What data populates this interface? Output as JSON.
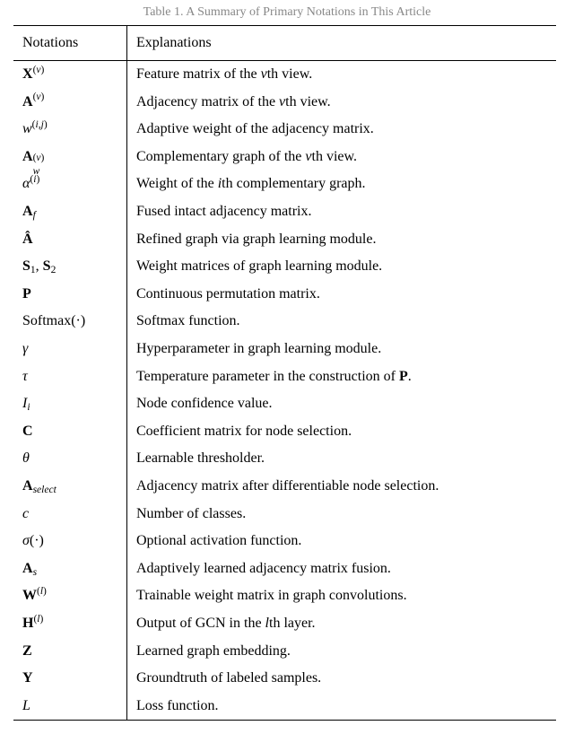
{
  "caption": "Table 1. A Summary of Primary Notations in This Article",
  "header": {
    "col1": "Notations",
    "col2": "Explanations"
  },
  "rows": [
    {
      "notation_html": "<span class='b'>X</span><span class='sup'>(<span class='i'>v</span>)</span>",
      "explanation_html": "Feature matrix of the <span class='i'>v</span>th view."
    },
    {
      "notation_html": "<span class='b'>A</span><span class='sup'>(<span class='i'>v</span>)</span>",
      "explanation_html": "Adjacency matrix of the <span class='i'>v</span>th view."
    },
    {
      "notation_html": "<span class='i'>w</span><span class='sup'>(<span class='i'>i</span>,<span class='i'>j</span>)</span>",
      "explanation_html": "Adaptive weight of the adjacency matrix."
    },
    {
      "notation_html": "<span class='b'>A</span><span class='subsup'><span class='st'>(<span class='i'>v</span>)</span><span class='sb i'>w</span></span><span style='display:inline-block;width:18px'></span>",
      "explanation_html": "Complementary graph of the <span class='i'>v</span>th view."
    },
    {
      "notation_html": "<span class='i'>α</span><span class='sup'>(<span class='i'>i</span>)</span>",
      "explanation_html": "Weight of the <span class='i'>i</span>th complementary graph."
    },
    {
      "notation_html": "<span class='b'>A</span><span class='sub i'>f</span>",
      "explanation_html": "Fused intact adjacency matrix."
    },
    {
      "notation_html": "<span class='b'>Â</span>",
      "explanation_html": "Refined graph via graph learning module."
    },
    {
      "notation_html": "<span class='b'>S</span><span class='sub'>1</span>, <span class='b'>S</span><span class='sub'>2</span>",
      "explanation_html": "Weight matrices of graph learning module."
    },
    {
      "notation_html": "<span class='b'>P</span>",
      "explanation_html": "Continuous permutation matrix."
    },
    {
      "notation_html": "Softmax(·)",
      "explanation_html": "Softmax function."
    },
    {
      "notation_html": "<span class='i'>γ</span>",
      "explanation_html": "Hyperparameter in graph learning module."
    },
    {
      "notation_html": "<span class='i'>τ</span>",
      "explanation_html": "Temperature parameter in the construction of <span class='b'>P</span>."
    },
    {
      "notation_html": "<span class='i'>I</span><span class='sub i'>i</span>",
      "explanation_html": "Node confidence value."
    },
    {
      "notation_html": "<span class='b'>C</span>",
      "explanation_html": "Coefficient matrix for node selection."
    },
    {
      "notation_html": "<span class='i'>θ</span>",
      "explanation_html": "Learnable thresholder."
    },
    {
      "notation_html": "<span class='b'>A</span><span class='sub i'>select</span>",
      "explanation_html": "Adjacency matrix after differentiable node selection."
    },
    {
      "notation_html": "<span class='i'>c</span>",
      "explanation_html": "Number of classes."
    },
    {
      "notation_html": "<span class='i'>σ</span>(·)",
      "explanation_html": "Optional activation function."
    },
    {
      "notation_html": "<span class='b'>A</span><span class='sub i'>s</span>",
      "explanation_html": "Adaptively learned adjacency matrix fusion."
    },
    {
      "notation_html": "<span class='b'>W</span><span class='sup'>(<span class='i'>l</span>)</span>",
      "explanation_html": "Trainable weight matrix in graph convolutions."
    },
    {
      "notation_html": "<span class='b'>H</span><span class='sup'>(<span class='i'>l</span>)</span>",
      "explanation_html": "Output of GCN in the <span class='i'>l</span>th layer."
    },
    {
      "notation_html": "<span class='b'>Z</span>",
      "explanation_html": "Learned graph embedding."
    },
    {
      "notation_html": "<span class='b'>Y</span>",
      "explanation_html": "Groundtruth of labeled samples."
    },
    {
      "notation_html": "<span class='cal'>L</span>",
      "explanation_html": "Loss function."
    }
  ],
  "chart_data": {
    "type": "table",
    "title": "A Summary of Primary Notations in This Article",
    "columns": [
      "Notations",
      "Explanations"
    ],
    "rows": [
      [
        "X^(v)",
        "Feature matrix of the vth view."
      ],
      [
        "A^(v)",
        "Adjacency matrix of the vth view."
      ],
      [
        "w^(i,j)",
        "Adaptive weight of the adjacency matrix."
      ],
      [
        "A_w^(v)",
        "Complementary graph of the vth view."
      ],
      [
        "alpha^(i)",
        "Weight of the ith complementary graph."
      ],
      [
        "A_f",
        "Fused intact adjacency matrix."
      ],
      [
        "A_hat",
        "Refined graph via graph learning module."
      ],
      [
        "S_1, S_2",
        "Weight matrices of graph learning module."
      ],
      [
        "P",
        "Continuous permutation matrix."
      ],
      [
        "Softmax(.)",
        "Softmax function."
      ],
      [
        "gamma",
        "Hyperparameter in graph learning module."
      ],
      [
        "tau",
        "Temperature parameter in the construction of P."
      ],
      [
        "I_i",
        "Node confidence value."
      ],
      [
        "C",
        "Coefficient matrix for node selection."
      ],
      [
        "theta",
        "Learnable thresholder."
      ],
      [
        "A_select",
        "Adjacency matrix after differentiable node selection."
      ],
      [
        "c",
        "Number of classes."
      ],
      [
        "sigma(.)",
        "Optional activation function."
      ],
      [
        "A_s",
        "Adaptively learned adjacency matrix fusion."
      ],
      [
        "W^(l)",
        "Trainable weight matrix in graph convolutions."
      ],
      [
        "H^(l)",
        "Output of GCN in the lth layer."
      ],
      [
        "Z",
        "Learned graph embedding."
      ],
      [
        "Y",
        "Groundtruth of labeled samples."
      ],
      [
        "L (script)",
        "Loss function."
      ]
    ]
  }
}
